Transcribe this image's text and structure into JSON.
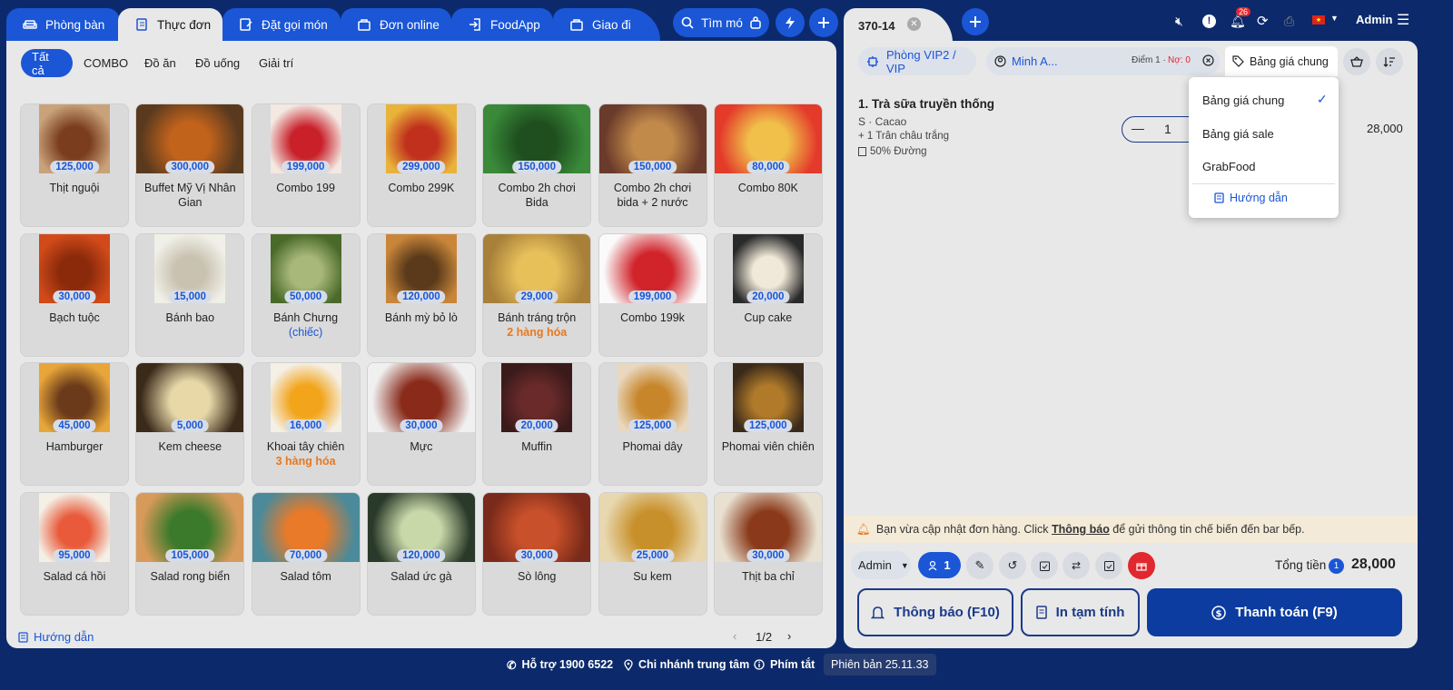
{
  "topnav": {
    "tabs": [
      {
        "label": "Phòng bàn",
        "icon": "sofa-icon"
      },
      {
        "label": "Thực đơn",
        "icon": "menu-book-icon"
      },
      {
        "label": "Đặt gọi món",
        "icon": "order-edit-icon"
      },
      {
        "label": "Đơn online",
        "icon": "bag-icon"
      },
      {
        "label": "FoodApp",
        "icon": "login-icon"
      },
      {
        "label": "Giao đi",
        "icon": "bag-icon"
      }
    ],
    "search_label": "Tìm mó"
  },
  "categories": [
    "Tất cả",
    "COMBO",
    "Đồ ăn",
    "Đồ uống",
    "Giải trí"
  ],
  "products": [
    {
      "name": "Thịt nguội",
      "price": "125,000"
    },
    {
      "name": "Buffet Mỹ Vị Nhân Gian",
      "price": "300,000"
    },
    {
      "name": "Combo 199",
      "price": "199,000"
    },
    {
      "name": "Combo 299K",
      "price": "299,000"
    },
    {
      "name": "Combo 2h chơi Bida",
      "price": "150,000"
    },
    {
      "name": "Combo 2h chơi bida + 2 nước",
      "price": "150,000"
    },
    {
      "name": "Combo 80K",
      "price": "80,000"
    },
    {
      "name": "Bạch tuộc",
      "price": "30,000"
    },
    {
      "name": "Bánh bao",
      "price": "15,000"
    },
    {
      "name": "Bánh Chưng",
      "price": "50,000",
      "sub": "(chiếc)"
    },
    {
      "name": "Bánh mỳ bỏ lò",
      "price": "120,000"
    },
    {
      "name": "Bánh tráng trộn",
      "price": "29,000",
      "sub2": "2 hàng hóa"
    },
    {
      "name": "Combo 199k",
      "price": "199,000"
    },
    {
      "name": "Cup cake",
      "price": "20,000"
    },
    {
      "name": "Hamburger",
      "price": "45,000"
    },
    {
      "name": "Kem cheese",
      "price": "5,000"
    },
    {
      "name": "Khoai tây chiên",
      "price": "16,000",
      "sub2": "3 hàng hóa"
    },
    {
      "name": "Mực",
      "price": "30,000"
    },
    {
      "name": "Muffin",
      "price": "20,000"
    },
    {
      "name": "Phomai dây",
      "price": "125,000"
    },
    {
      "name": "Phomai viên chiên",
      "price": "125,000"
    },
    {
      "name": "Salad cá hồi",
      "price": "95,000"
    },
    {
      "name": "Salad rong biển",
      "price": "105,000"
    },
    {
      "name": "Salad tôm",
      "price": "70,000"
    },
    {
      "name": "Salad ức gà",
      "price": "120,000"
    },
    {
      "name": "Sò lông",
      "price": "30,000"
    },
    {
      "name": "Su kem",
      "price": "25,000"
    },
    {
      "name": "Thịt ba chỉ",
      "price": "30,000"
    }
  ],
  "left_footer": {
    "guide": "Hướng dẫn",
    "page": "1/2"
  },
  "order": {
    "tab": "370-14",
    "room": "Phòng VIP2 / VIP",
    "customer": "Minh A...",
    "points_label": "Điểm 1 · ",
    "debt_label": "Nợ: 0",
    "price_list": "Bảng giá chung",
    "item": {
      "title": "1. Trà sữa truyền thống",
      "size": "S · Cacao",
      "topping": "+ 1 Trân châu trắng",
      "note": "50% Đường",
      "qty": "1",
      "amount": "28,000"
    },
    "notice": {
      "pre": "Bạn vừa cập nhật đơn hàng. Click ",
      "link": "Thông báo",
      "post": " để gửi thông tin chế biến đến bar bếp."
    },
    "staff": "Admin",
    "guests": "1",
    "total_label": "Tổng tiền",
    "total_count": "1",
    "total": "28,000",
    "btn_notify": "Thông báo (F10)",
    "btn_print": "In tạm tính",
    "btn_pay": "Thanh toán (F9)"
  },
  "dropdown": {
    "items": [
      "Bảng giá chung",
      "Bảng giá sale",
      "GrabFood"
    ],
    "guide": "Hướng dẫn"
  },
  "header_right": {
    "notif_count": "26",
    "user": "Admin"
  },
  "footer": {
    "support": "Hỗ trợ 1900 6522",
    "branch": "Chi nhánh trung tâm",
    "shortcut": "Phím tắt",
    "version": "Phiên bản 25.11.33"
  },
  "colors": {
    "primary": "#1a56d6",
    "navy": "#0c2a6b",
    "price": "#1a56d6",
    "orange": "#e8781e",
    "gift": "#e0282e"
  }
}
